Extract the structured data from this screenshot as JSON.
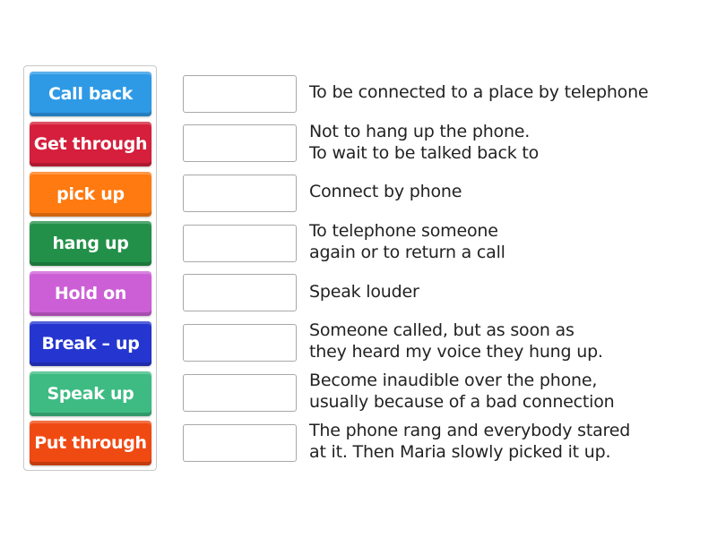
{
  "tiles": [
    {
      "label": "Call back",
      "color": "#2e9ae6"
    },
    {
      "label": "Get through",
      "color": "#d51f3c"
    },
    {
      "label": "pick up",
      "color": "#ff7a10"
    },
    {
      "label": "hang up",
      "color": "#239049"
    },
    {
      "label": "Hold on",
      "color": "#cc5fd6"
    },
    {
      "label": "Break – up",
      "color": "#2536d0"
    },
    {
      "label": "Speak up",
      "color": "#3dbb83"
    },
    {
      "label": "Put through",
      "color": "#f04a13"
    }
  ],
  "definitions": [
    {
      "line1": "To be connected to a place by telephone",
      "line2": ""
    },
    {
      "line1": "Not to hang up the phone.",
      "line2": "To wait to be talked back to"
    },
    {
      "line1": "Connect by phone",
      "line2": ""
    },
    {
      "line1": "To telephone someone",
      "line2": "again or to return a call"
    },
    {
      "line1": "Speak louder",
      "line2": ""
    },
    {
      "line1": "Someone called, but as soon as",
      "line2": "they heard my voice they hung up."
    },
    {
      "line1": "Become inaudible over the phone,",
      "line2": "usually because of a bad connection"
    },
    {
      "line1": "The phone rang and everybody stared",
      "line2": "at it. Then Maria slowly picked it up."
    }
  ]
}
